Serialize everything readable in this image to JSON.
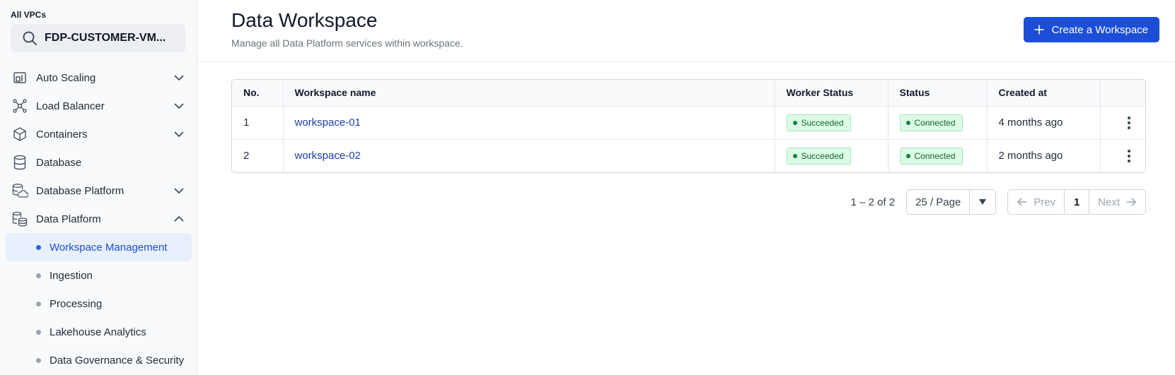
{
  "sidebar": {
    "vpc_label": "All VPCs",
    "vpc_search_value": "FDP-CUSTOMER-VM...",
    "items": [
      {
        "label": "Auto Scaling",
        "icon": "auto-scaling-icon",
        "expanded": false
      },
      {
        "label": "Load Balancer",
        "icon": "load-balancer-icon",
        "expanded": false
      },
      {
        "label": "Containers",
        "icon": "containers-icon",
        "expanded": false
      },
      {
        "label": "Database",
        "icon": "database-icon"
      },
      {
        "label": "Database Platform",
        "icon": "database-platform-icon",
        "expanded": false
      },
      {
        "label": "Data Platform",
        "icon": "data-platform-icon",
        "expanded": true
      }
    ],
    "sub_items": [
      {
        "label": "Workspace Management",
        "active": true
      },
      {
        "label": "Ingestion",
        "active": false
      },
      {
        "label": "Processing",
        "active": false
      },
      {
        "label": "Lakehouse Analytics",
        "active": false
      },
      {
        "label": "Data Governance & Security",
        "active": false
      }
    ]
  },
  "header": {
    "title": "Data Workspace",
    "subtitle": "Manage all Data Platform services within workspace.",
    "create_button": "Create a Workspace"
  },
  "table": {
    "columns": [
      "No.",
      "Workspace name",
      "Worker Status",
      "Status",
      "Created at"
    ],
    "rows": [
      {
        "no": "1",
        "name": "workspace-01",
        "worker_status": "Succeeded",
        "status": "Connected",
        "created": "4 months ago"
      },
      {
        "no": "2",
        "name": "workspace-02",
        "worker_status": "Succeeded",
        "status": "Connected",
        "created": "2 months ago"
      }
    ]
  },
  "pagination": {
    "range": "1 – 2 of 2",
    "per_page": "25 / Page",
    "prev": "Prev",
    "page": "1",
    "next": "Next"
  },
  "colors": {
    "accent": "#1d4ed8",
    "success_bg": "#dcfce7",
    "success_text": "#166534",
    "active_bg": "#e8f0fd"
  }
}
